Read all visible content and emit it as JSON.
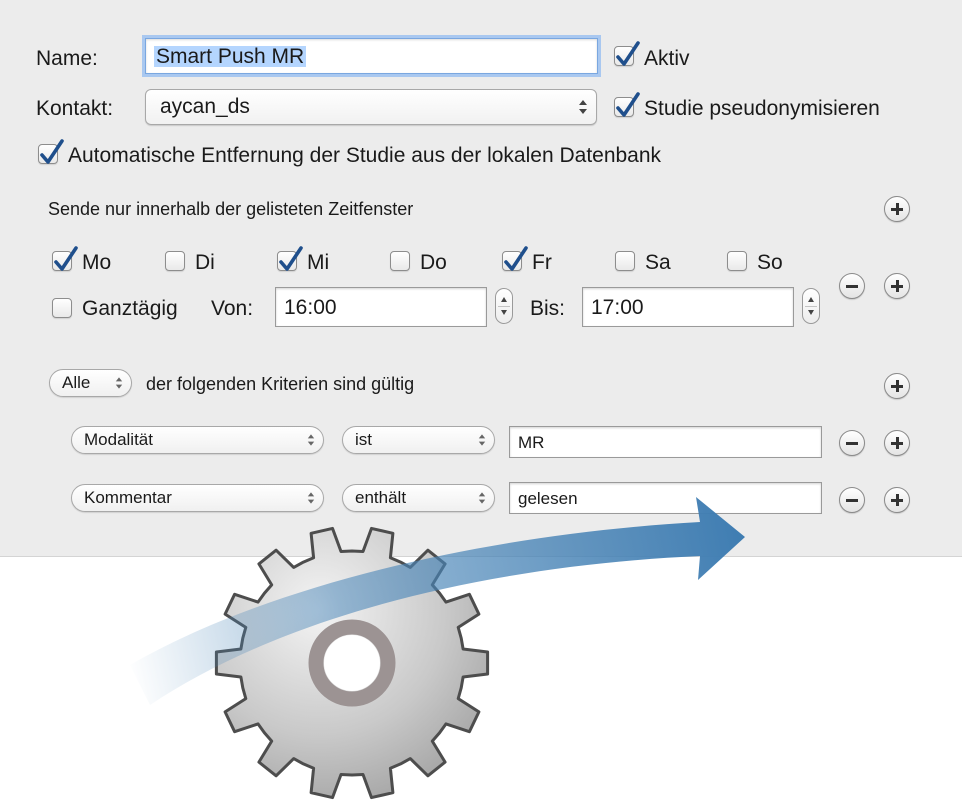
{
  "form": {
    "name_label": "Name:",
    "name_value": "Smart Push MR",
    "aktiv_label": "Aktiv",
    "aktiv_checked": true,
    "kontakt_label": "Kontakt:",
    "kontakt_value": "aycan_ds",
    "pseudonym_label": "Studie pseudonymisieren",
    "pseudonym_checked": true,
    "auto_remove_label": "Automatische Entfernung der Studie aus der lokalen Datenbank",
    "auto_remove_checked": true
  },
  "timewindow": {
    "heading": "Sende nur innerhalb der gelisteten Zeitfenster",
    "days": [
      {
        "label": "Mo",
        "checked": true
      },
      {
        "label": "Di",
        "checked": false
      },
      {
        "label": "Mi",
        "checked": true
      },
      {
        "label": "Do",
        "checked": false
      },
      {
        "label": "Fr",
        "checked": true
      },
      {
        "label": "Sa",
        "checked": false
      },
      {
        "label": "So",
        "checked": false
      }
    ],
    "allday_label": "Ganztägig",
    "allday_checked": false,
    "from_label": "Von:",
    "from_value": "16:00",
    "to_label": "Bis:",
    "to_value": "17:00"
  },
  "criteria": {
    "match_value": "Alle",
    "match_text": "der folgenden Kriterien sind gültig",
    "rules": [
      {
        "field": "Modalität",
        "operator": "ist",
        "value": "MR"
      },
      {
        "field": "Kommentar",
        "operator": "enthält",
        "value": "gelesen"
      }
    ]
  },
  "icons": {
    "gear": "gear-icon",
    "arrow": "arrow-icon",
    "add": "plus-icon",
    "remove": "minus-icon",
    "checkmark": "checkmark-icon"
  },
  "colors": {
    "accent_blue": "#2a6db0",
    "arrow_blue": "#4a86b8",
    "gear_gray": "#9a9a9a"
  }
}
